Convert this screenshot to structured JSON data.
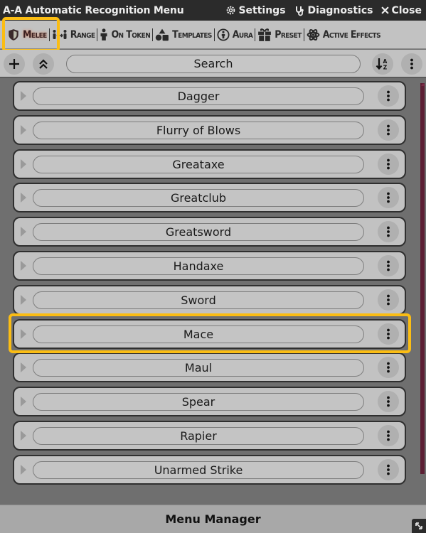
{
  "window": {
    "title": "A-A Automatic Recognition Menu",
    "header_buttons": [
      {
        "label": "Settings",
        "icon": "gear-icon"
      },
      {
        "label": "Diagnostics",
        "icon": "stethoscope-icon"
      },
      {
        "label": "Close",
        "icon": "close-icon"
      }
    ]
  },
  "tabs": [
    {
      "label": "Melee",
      "icon": "shield-icon",
      "active": true
    },
    {
      "label": "Range",
      "icon": "range-icon",
      "active": false
    },
    {
      "label": "On Token",
      "icon": "person-icon",
      "active": false
    },
    {
      "label": "Templates",
      "icon": "shapes-icon",
      "active": false
    },
    {
      "label": "Aura",
      "icon": "aura-icon",
      "active": false
    },
    {
      "label": "Preset",
      "icon": "gift-icon",
      "active": false
    },
    {
      "label": "Active Effects",
      "icon": "atom-icon",
      "active": false
    }
  ],
  "toolbar": {
    "add_icon": "plus-icon",
    "collapse_icon": "double-chevron-up-icon",
    "search_label": "Search",
    "sort_icon": "sort-alpha-icon",
    "menu_icon": "kebab-icon"
  },
  "items": [
    {
      "name": "Dagger"
    },
    {
      "name": "Flurry of Blows"
    },
    {
      "name": "Greataxe"
    },
    {
      "name": "Greatclub"
    },
    {
      "name": "Greatsword"
    },
    {
      "name": "Handaxe"
    },
    {
      "name": "Sword"
    },
    {
      "name": "Mace"
    },
    {
      "name": "Maul"
    },
    {
      "name": "Spear"
    },
    {
      "name": "Rapier"
    },
    {
      "name": "Unarmed Strike"
    }
  ],
  "highlighted_item": "Mace",
  "footer": {
    "label": "Menu Manager"
  },
  "colors": {
    "highlight": "#fbbd13",
    "scrollbar": "#5c1f34",
    "titlebar": "#2b2b2b"
  }
}
